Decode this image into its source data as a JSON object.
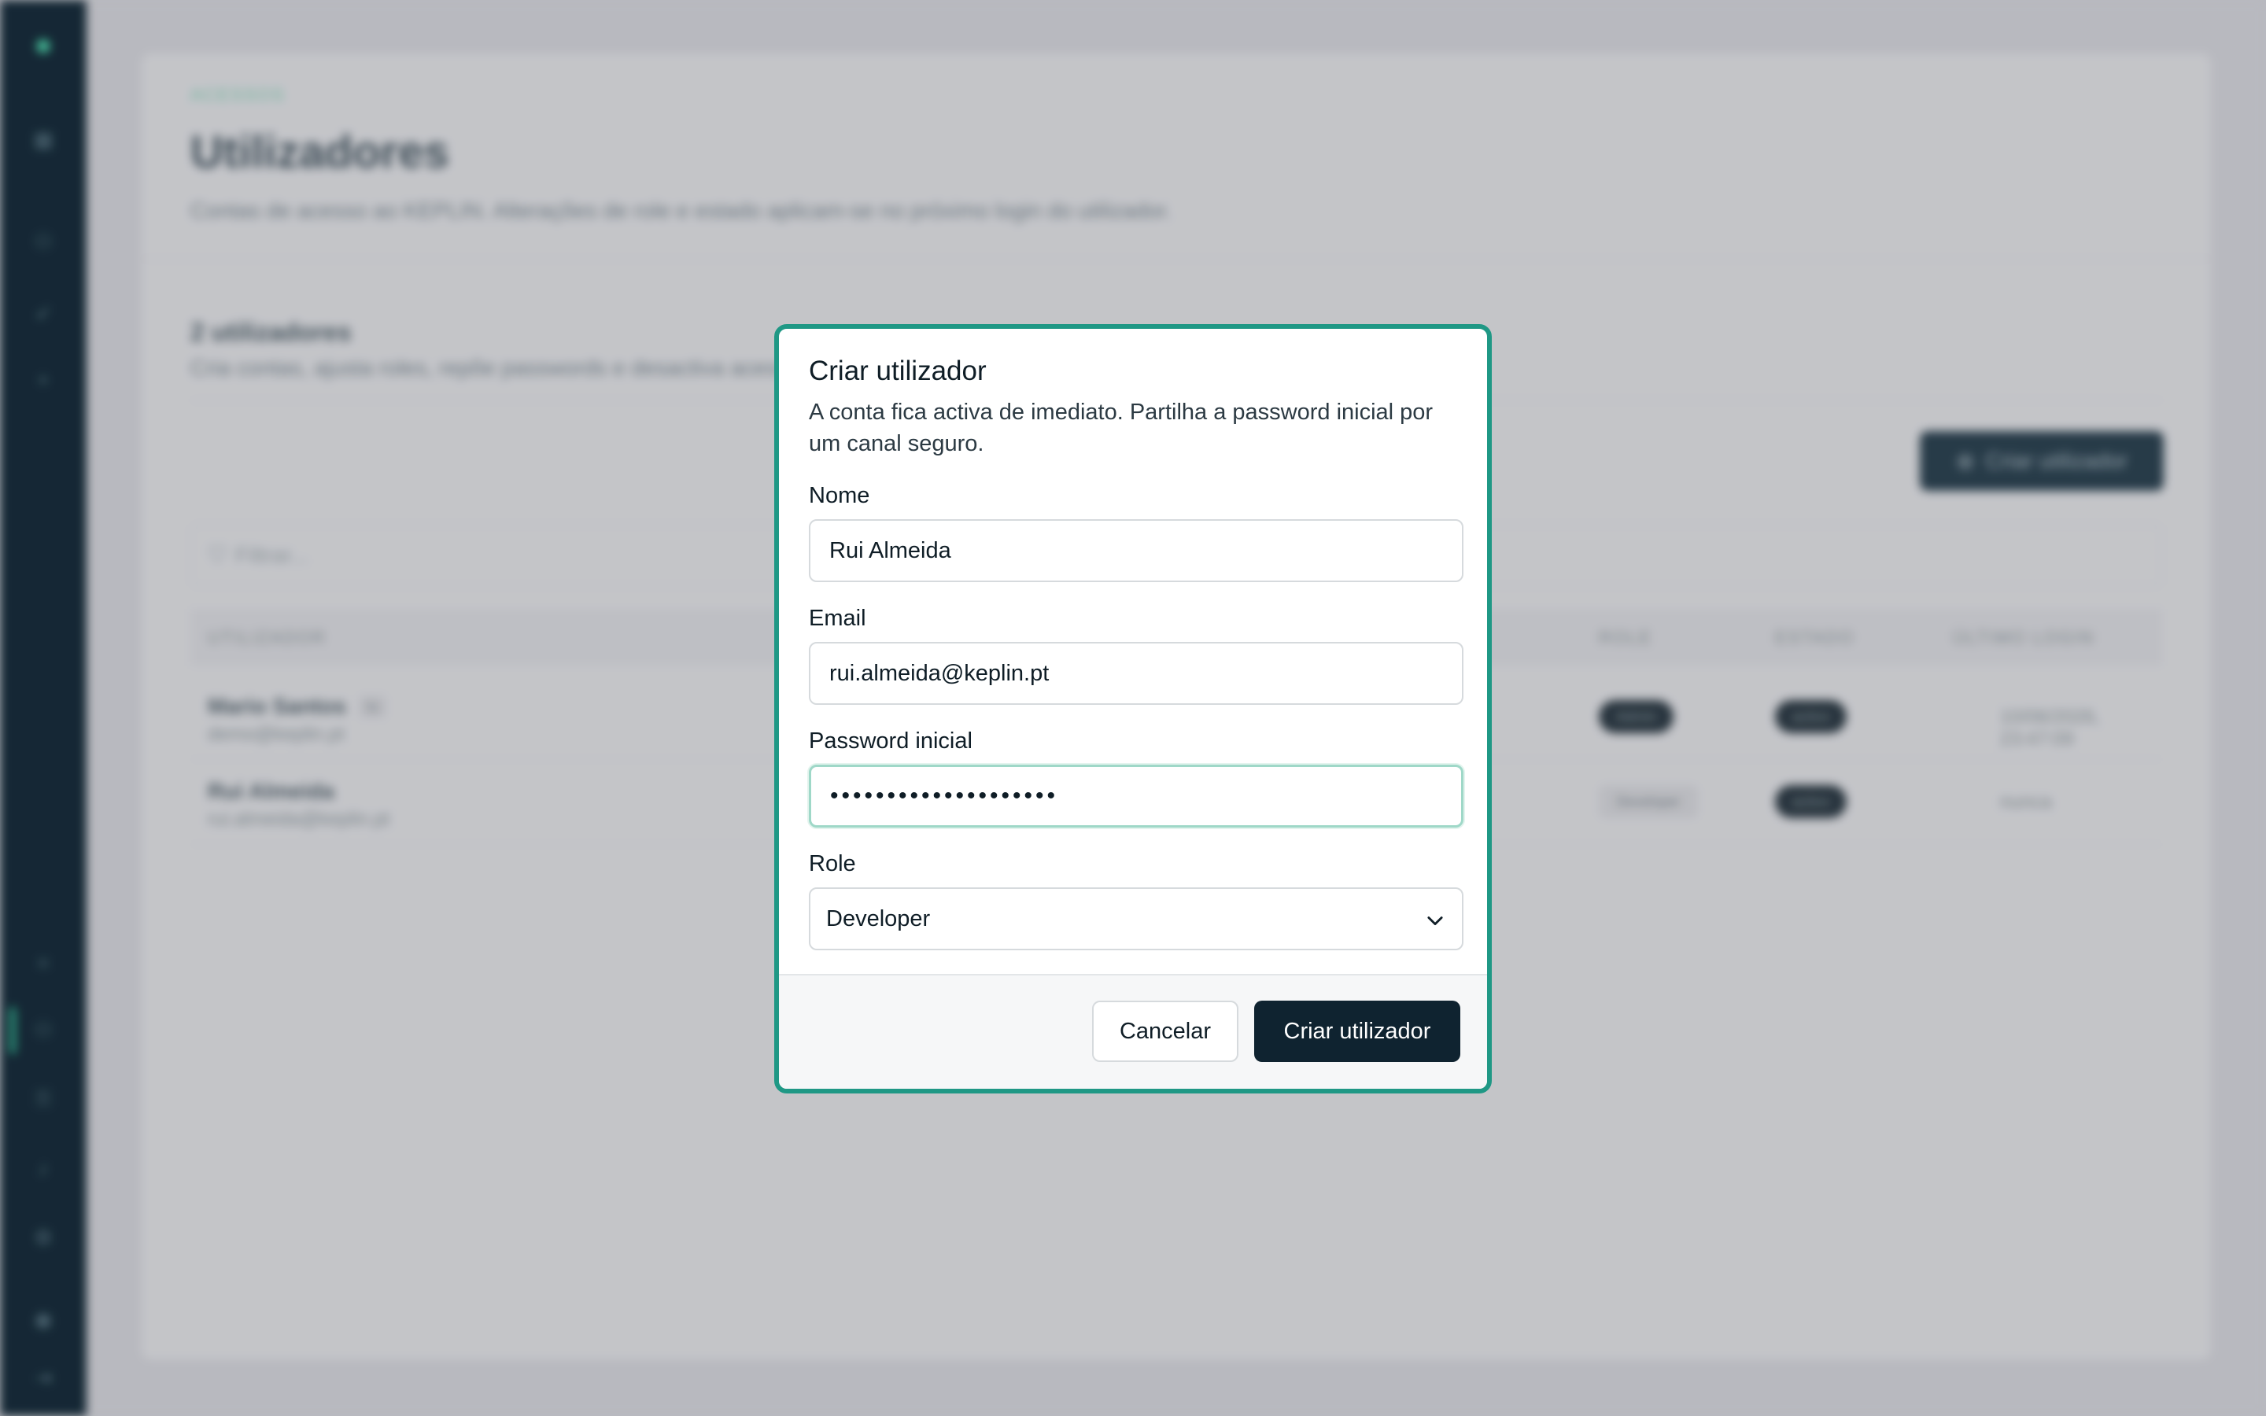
{
  "background": {
    "breadcrumb": "ACESSOS",
    "page_title": "Utilizadores",
    "page_subtitle": "Contas de acesso ao KEPLIN. Alterações de role e estado aplicam-se no próximo login do utilizador.",
    "section_title": "2 utilizadores",
    "section_subtitle": "Cria contas, ajusta roles, repõe passwords e desactiva acessos.",
    "create_button_label": "Criar utilizador",
    "filter_placeholder": "Filtrar...",
    "table": {
      "columns": [
        "UTILIZADOR",
        "ROLE",
        "ESTADO",
        "ÚLTIMO LOGIN"
      ],
      "rows": [
        {
          "name": "Mario Santos",
          "tag": "tu",
          "email": "demo@keplin.pt",
          "role": "Admin",
          "status": "activo",
          "last_login": "10/06/2026, 23:47:09"
        },
        {
          "name": "Rui Almeida",
          "email": "rui.almeida@keplin.pt",
          "role": "Developer",
          "status": "activo",
          "last_login": "nunca"
        }
      ]
    }
  },
  "modal": {
    "title": "Criar utilizador",
    "description": "A conta fica activa de imediato. Partilha a password inicial por um canal seguro.",
    "name_label": "Nome",
    "name_value": "Rui Almeida",
    "email_label": "Email",
    "email_value": "rui.almeida@keplin.pt",
    "password_label": "Password inicial",
    "password_value": "••••••••••••••••••••",
    "role_label": "Role",
    "role_value": "Developer",
    "cancel_label": "Cancelar",
    "submit_label": "Criar utilizador"
  },
  "colors": {
    "sidebar": "#0f2330",
    "modal_border": "#1f9885",
    "primary_button": "#0f2330"
  }
}
